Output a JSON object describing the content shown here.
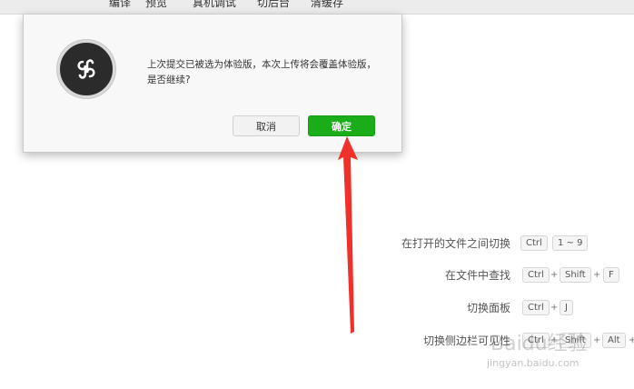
{
  "toolbar": {
    "items": [
      "编译",
      "预览",
      "真机调试",
      "切后台",
      "清缓存"
    ]
  },
  "dialog": {
    "message": "上次提交已被选为体验版，本次上传将会覆盖体验版，是否继续?",
    "cancel_label": "取消",
    "confirm_label": "确定"
  },
  "shortcuts": [
    {
      "label": "在打开的文件之间切换",
      "keys": [
        "Ctrl",
        "1 ~ 9"
      ]
    },
    {
      "label": "在文件中查找",
      "keys": [
        "Ctrl",
        "+",
        "Shift",
        "+",
        "F"
      ]
    },
    {
      "label": "切换面板",
      "keys": [
        "Ctrl",
        "+",
        "J"
      ]
    },
    {
      "label": "切换侧边栏可见性",
      "keys": [
        "Ctrl",
        "+",
        "Shift",
        "+",
        "Alt",
        "+"
      ]
    }
  ],
  "watermark": {
    "text": "Baidu经验",
    "sub": "jingyan.baidu.com"
  },
  "colors": {
    "confirm": "#1aad19",
    "arrow": "#f0302a"
  }
}
